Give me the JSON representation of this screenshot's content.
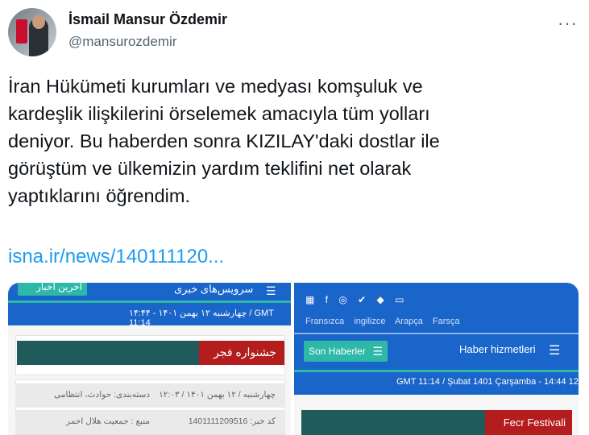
{
  "tweet": {
    "author_name": "İsmail Mansur Özdemir",
    "author_handle": "@mansurozdemir",
    "more_icon": "more-dots-icon",
    "text": "İran Hükümeti kurumları ve medyası komşuluk ve\nkardeşlik ilişkilerini örselemek amacıyla tüm yolları\ndeniyor. Bu haberden sonra KIZILAY'daki dostlar ile\ngörüştüm ve ülkemizin yardım teklifini net olarak\nyaptıklarını öğrendim.",
    "link": "isna.ir/news/140111120..."
  },
  "left_image": {
    "tab_label": "آخرین اخبار",
    "menu_label": "سرویس‌های خبری",
    "menu_icon": "menu-icon",
    "date_line": "چهارشنبه ۱۲ بهمن ۱۴۰۱ - ۱۴:۴۴ / GMT 11:14",
    "section_title": "جشنواره فجر",
    "row1_date": "چهارشنبه / ۱۲ بهمن ۱۴۰۱ / ۱۲:۰۳",
    "row1_category": "دسته‌بندی: حوادث، انتظامی",
    "row2_code": "کد خبر: 1401111209516",
    "row2_source": "منبع : جمعیت هلال احمر"
  },
  "right_image": {
    "social_icons": "▦ f ◎ ✔  ◆ ▭",
    "languages": [
      "Fransızca",
      "ingilizce",
      "Arapça",
      "Farsça"
    ],
    "son_haberler": "Son Haberler",
    "haber_hizmetleri": "Haber hizmetleri",
    "date_line": "GMT 11:14  /  Şubat 1401 Çarşamba - 14:44 12",
    "section_title": "Fecr Festivali"
  },
  "colors": {
    "link": "#1d9bf0",
    "header_blue": "#1a65c9",
    "accent_teal": "#2eb8a8",
    "bar_teal": "#1f5b5a",
    "bar_red": "#b31d1d"
  }
}
